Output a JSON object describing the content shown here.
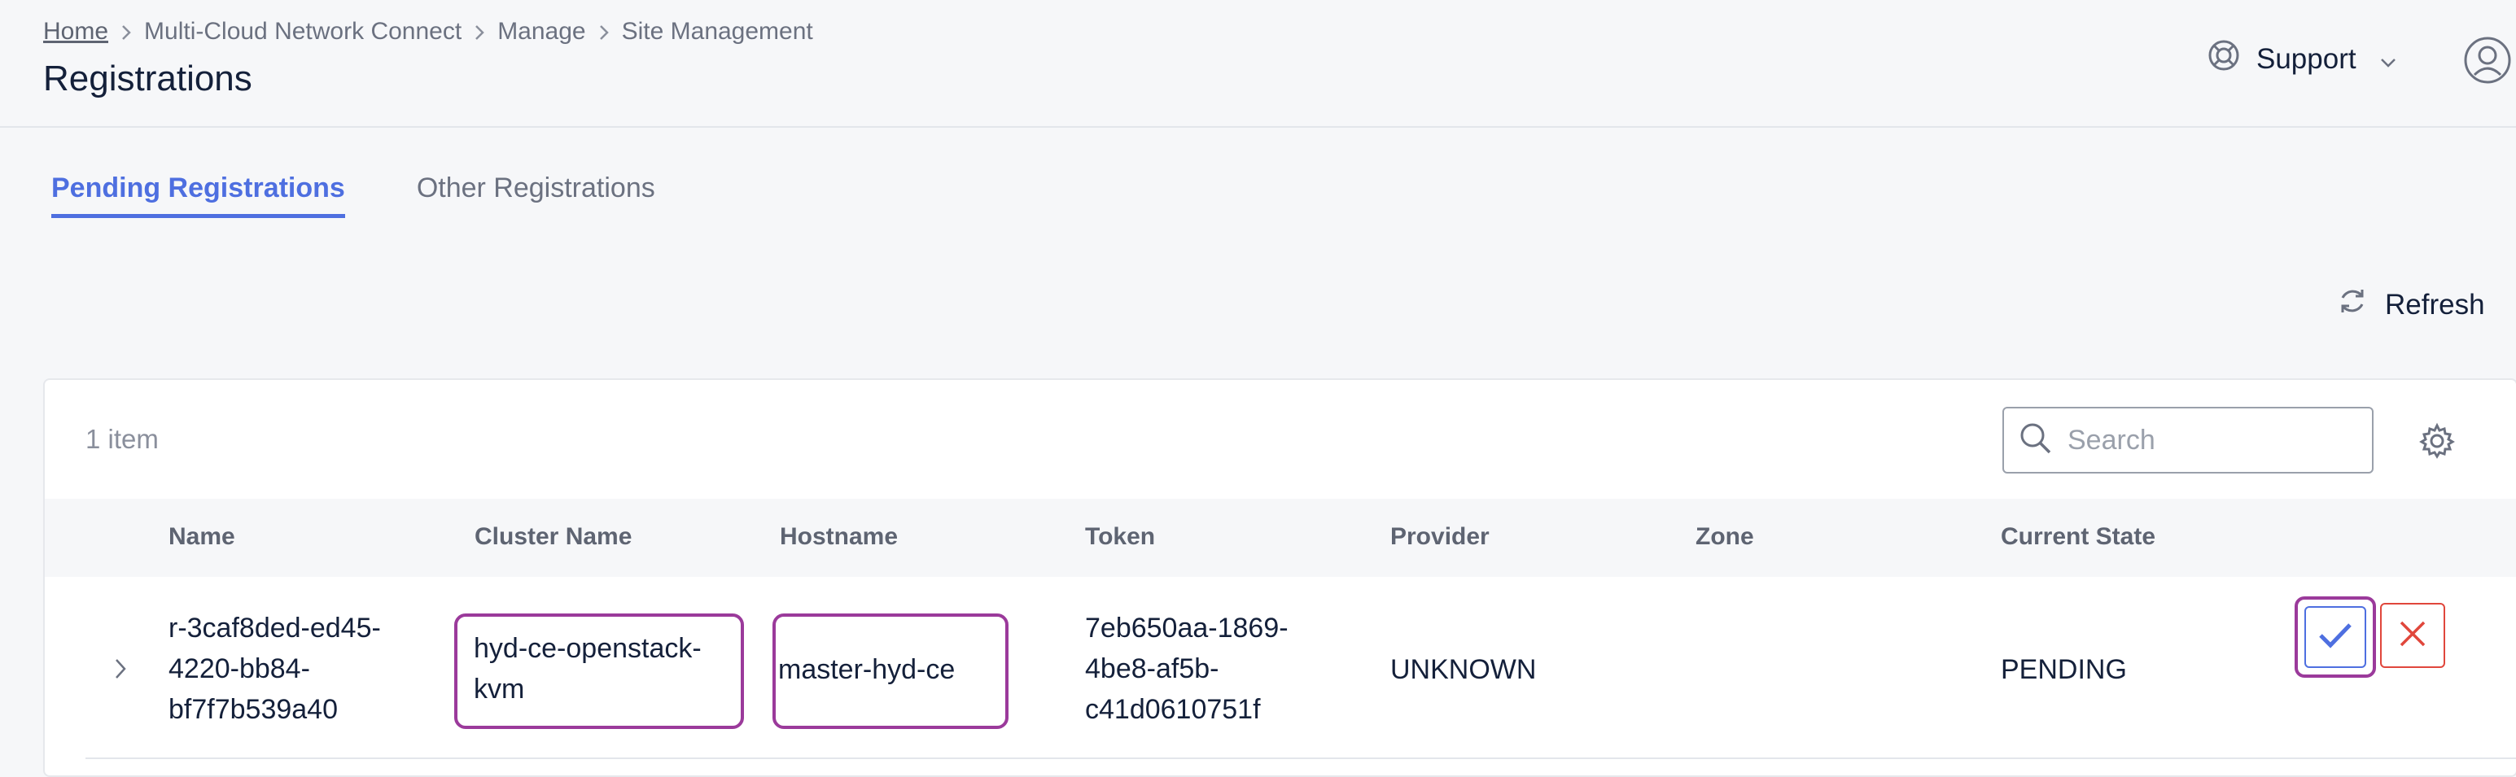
{
  "breadcrumb": {
    "items": [
      "Home",
      "Multi-Cloud Network Connect",
      "Manage",
      "Site Management"
    ]
  },
  "header": {
    "title": "Registrations",
    "support_label": "Support"
  },
  "tabs": [
    {
      "label": "Pending Registrations",
      "active": true
    },
    {
      "label": "Other Registrations",
      "active": false
    }
  ],
  "toolbar": {
    "refresh_label": "Refresh"
  },
  "table": {
    "item_count": "1 item",
    "search_placeholder": "Search",
    "columns": [
      "Name",
      "Cluster Name",
      "Hostname",
      "Token",
      "Provider",
      "Zone",
      "Current State"
    ],
    "rows": [
      {
        "name": "r-3caf8ded-ed45-\n4220-bb84-\nbf7f7b539a40",
        "cluster_name": "hyd-ce-openstack-\nkvm",
        "hostname": "master-hyd-ce",
        "token": "7eb650aa-1869-\n4be8-af5b-\nc41d0610751f",
        "provider": "UNKNOWN",
        "zone": "",
        "current_state": "PENDING"
      }
    ]
  },
  "colors": {
    "accent": "#4e6fe0",
    "highlight": "#9b3a9b",
    "danger": "#e0473c"
  },
  "icons": {
    "support": "lifebuoy-icon",
    "support_dropdown": "chevron-down-icon",
    "user": "user-avatar-icon",
    "refresh": "refresh-icon",
    "search": "search-icon",
    "settings": "gear-icon",
    "expand": "chevron-right-icon",
    "approve": "check-icon",
    "reject": "close-icon"
  }
}
